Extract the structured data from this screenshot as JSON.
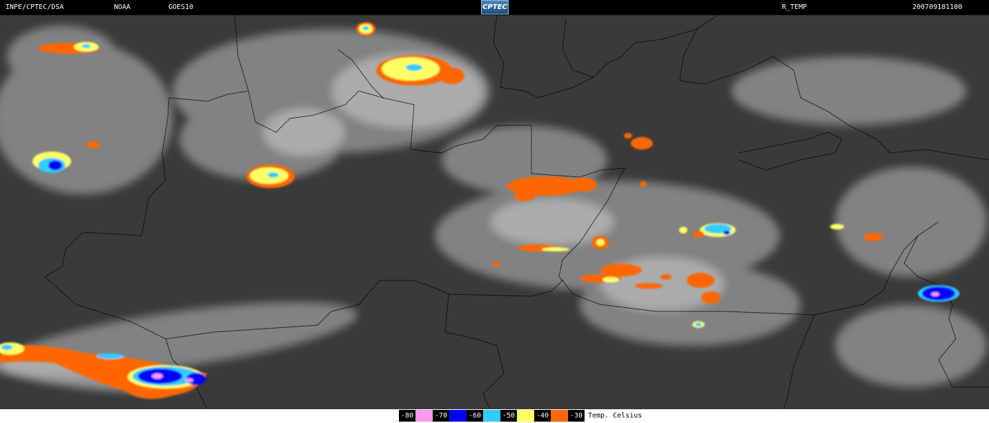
{
  "header": {
    "source": "INPE/CPTEC/DSA",
    "agency": "NOAA",
    "satellite": "GOES10",
    "product": "R_TEMP",
    "datetime": "200709181100",
    "logo_text": "CPTEC"
  },
  "legend": {
    "items": [
      {
        "label": "-80",
        "color": "#ff99ee"
      },
      {
        "label": "-70",
        "color": "#0000ff"
      },
      {
        "label": "-60",
        "color": "#33ccff"
      },
      {
        "label": "-50",
        "color": "#ffff66"
      },
      {
        "label": "-40",
        "color": "#ff6600"
      },
      {
        "label": "-30",
        "color": null
      }
    ],
    "title": "Temp. Celsius"
  },
  "colors": {
    "background": "#3c3c3c",
    "cloud": "#c8c8c8",
    "border": "#000000"
  }
}
